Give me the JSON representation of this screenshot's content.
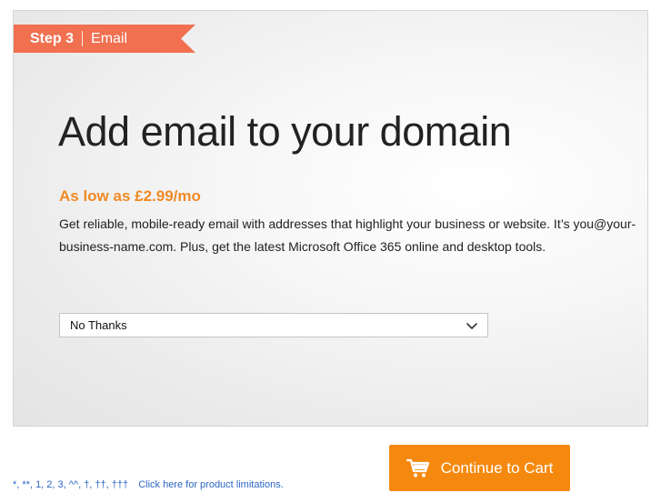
{
  "step": {
    "number_label": "Step 3",
    "name": "Email"
  },
  "headline": "Add email to your domain",
  "price_line": "As low as £2.99/mo",
  "description": "Get reliable, mobile-ready email with addresses that highlight your business or website. It’s you@your-business-name.com. Plus, get the latest Microsoft Office 365 online and desktop tools.",
  "email_plan_select": {
    "selected_value": "No Thanks"
  },
  "footnotes": {
    "marks": "*, **, 1, 2, 3, ^^, †, ††, †††",
    "limitations_link": "Click here for product limitations."
  },
  "cart_button": {
    "label": "Continue to Cart",
    "icon": "shopping-cart-icon"
  },
  "colors": {
    "step_banner": "#f07050",
    "price": "#f08a24",
    "cart_button": "#f5890f",
    "link": "#2b66c2"
  }
}
